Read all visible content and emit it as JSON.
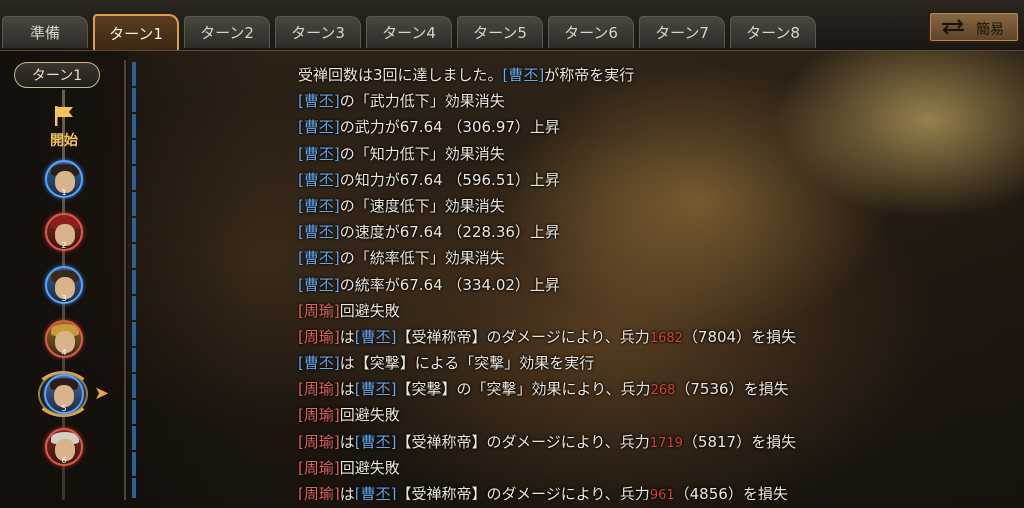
{
  "tabs": [
    {
      "label": "準備",
      "active": false
    },
    {
      "label": "ターン1",
      "active": true
    },
    {
      "label": "ターン2",
      "active": false
    },
    {
      "label": "ターン3",
      "active": false
    },
    {
      "label": "ターン4",
      "active": false
    },
    {
      "label": "ターン5",
      "active": false
    },
    {
      "label": "ターン6",
      "active": false
    },
    {
      "label": "ターン7",
      "active": false
    },
    {
      "label": "ターン8",
      "active": false
    }
  ],
  "header": {
    "simple_label": "簡易",
    "swap_icon": "swap-arrows-icon"
  },
  "timeline": {
    "turn_label": "ターン1",
    "start_label": "開始",
    "start_icon": "flag-icon",
    "units": [
      {
        "num": "1",
        "side": "blue"
      },
      {
        "num": "2",
        "side": "red"
      },
      {
        "num": "3",
        "side": "blue"
      },
      {
        "num": "4",
        "side": "red"
      },
      {
        "num": "5",
        "side": "blue",
        "selected": true
      },
      {
        "num": "6",
        "side": "red"
      }
    ]
  },
  "colors": {
    "ally": "#64a8ee",
    "enemy": "#e3665c",
    "damage": "#d24436",
    "accent": "#e0a049"
  },
  "log": [
    {
      "pre": "受禅回数は3回に達しました。",
      "name": "[曹丕]",
      "name_color": "blue",
      "post": "が称帝を実行"
    },
    {
      "name": "[曹丕]",
      "name_color": "blue",
      "post": "の「武力低下」効果消失"
    },
    {
      "name": "[曹丕]",
      "name_color": "blue",
      "post": "の武力が67.64 （306.97）上昇"
    },
    {
      "name": "[曹丕]",
      "name_color": "blue",
      "post": "の「知力低下」効果消失"
    },
    {
      "name": "[曹丕]",
      "name_color": "blue",
      "post": "の知力が67.64 （596.51）上昇"
    },
    {
      "name": "[曹丕]",
      "name_color": "blue",
      "post": "の「速度低下」効果消失"
    },
    {
      "name": "[曹丕]",
      "name_color": "blue",
      "post": "の速度が67.64 （228.36）上昇"
    },
    {
      "name": "[曹丕]",
      "name_color": "blue",
      "post": "の「統率低下」効果消失"
    },
    {
      "name": "[曹丕]",
      "name_color": "blue",
      "post": "の統率が67.64 （334.02）上昇"
    },
    {
      "name": "[周瑜]",
      "name_color": "red",
      "post": "回避失敗"
    },
    {
      "name": "[周瑜]",
      "name_color": "red",
      "mid": "は",
      "name2": "[曹丕]",
      "name2_color": "blue",
      "post": "【受禅称帝】のダメージにより、兵力",
      "dmg": "1682",
      "tail": "（7804）を損失"
    },
    {
      "name": "[曹丕]",
      "name_color": "blue",
      "post": "は【突撃】による「突撃」効果を実行"
    },
    {
      "name": "[周瑜]",
      "name_color": "red",
      "mid": "は",
      "name2": "[曹丕]",
      "name2_color": "blue",
      "post": "【突撃】の「突撃」効果により、兵力",
      "dmg": "268",
      "tail": "（7536）を損失"
    },
    {
      "name": "[周瑜]",
      "name_color": "red",
      "post": "回避失敗"
    },
    {
      "name": "[周瑜]",
      "name_color": "red",
      "mid": "は",
      "name2": "[曹丕]",
      "name2_color": "blue",
      "post": "【受禅称帝】のダメージにより、兵力",
      "dmg": "1719",
      "tail": "（5817）を損失"
    },
    {
      "name": "[周瑜]",
      "name_color": "red",
      "post": "回避失敗"
    },
    {
      "name": "[周瑜]",
      "name_color": "red",
      "mid": "は",
      "name2": "[曹丕]",
      "name2_color": "blue",
      "post": "【受禅称帝】のダメージにより、兵力",
      "dmg": "961",
      "tail": "（4856）を損失"
    }
  ]
}
